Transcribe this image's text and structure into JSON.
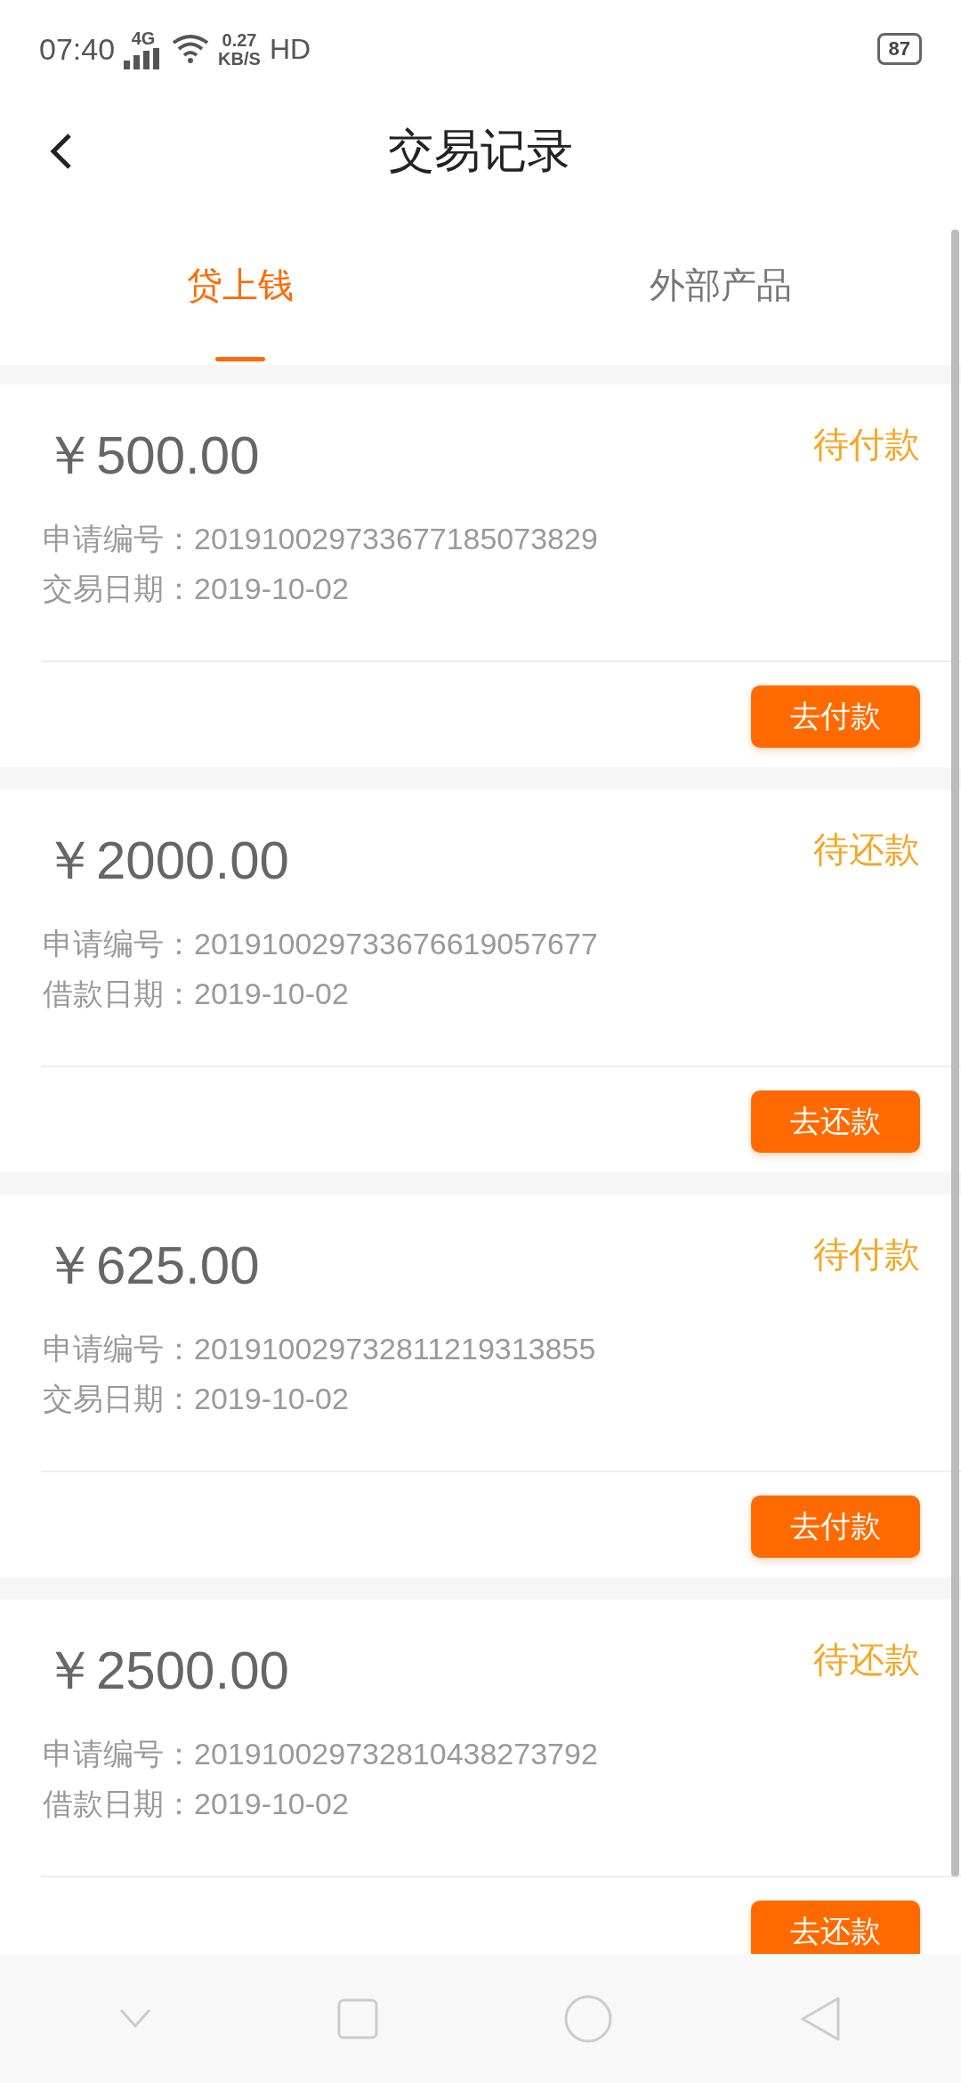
{
  "status_bar": {
    "time": "07:40",
    "network": "4G",
    "speed_value": "0.27",
    "speed_unit": "KB/S",
    "hd": "HD",
    "battery": "87"
  },
  "header": {
    "title": "交易记录"
  },
  "tabs": [
    {
      "label": "贷上钱",
      "selected": true
    },
    {
      "label": "外部产品",
      "selected": false
    }
  ],
  "records": [
    {
      "amount": "￥500.00",
      "status": "待付款",
      "number_label": "申请编号：",
      "number": "201910029733677185073829",
      "date_label": "交易日期：",
      "date": "2019-10-02",
      "action": "去付款"
    },
    {
      "amount": "￥2000.00",
      "status": "待还款",
      "number_label": "申请编号：",
      "number": "201910029733676619057677",
      "date_label": "借款日期：",
      "date": "2019-10-02",
      "action": "去还款"
    },
    {
      "amount": "￥625.00",
      "status": "待付款",
      "number_label": "申请编号：",
      "number": "201910029732811219313855",
      "date_label": "交易日期：",
      "date": "2019-10-02",
      "action": "去付款"
    },
    {
      "amount": "￥2500.00",
      "status": "待还款",
      "number_label": "申请编号：",
      "number": "201910029732810438273792",
      "date_label": "借款日期：",
      "date": "2019-10-02",
      "action": "去还款"
    }
  ]
}
